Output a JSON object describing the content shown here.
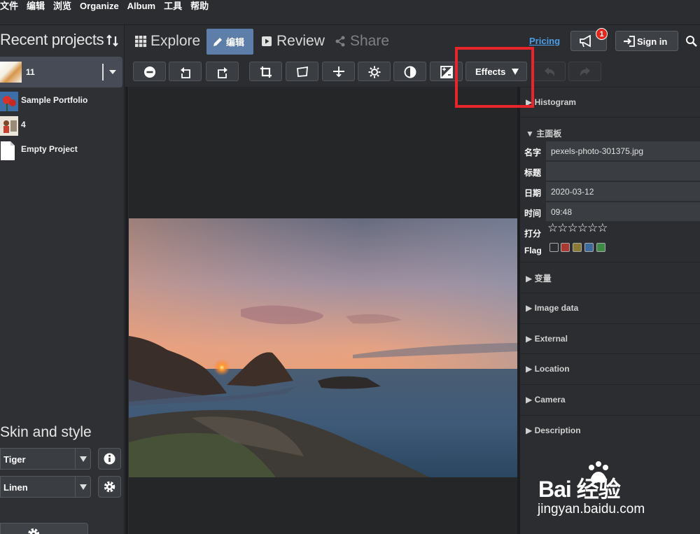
{
  "menubar": {
    "items": [
      "文件",
      "编辑",
      "浏览",
      "Organize",
      "Album",
      "工具",
      "帮助"
    ]
  },
  "sidebar": {
    "title": "Recent projects",
    "selected_project": "11",
    "projects": [
      {
        "label": "Sample Portfolio"
      },
      {
        "label": "4"
      },
      {
        "label": "Empty Project"
      }
    ],
    "skin_title": "Skin and style",
    "skin_select": "Tiger",
    "style_select": "Linen",
    "settings_label": "设置"
  },
  "header": {
    "tabs": {
      "explore": "Explore",
      "edit": "编辑",
      "review": "Review",
      "share": "Share"
    },
    "pricing": "Pricing",
    "notification_count": "1",
    "signin": "Sign in"
  },
  "toolbar": {
    "effects_label": "Effects"
  },
  "right_panel": {
    "histogram": "Histogram",
    "main_panel": "主面板",
    "fields": [
      {
        "key": "名字",
        "value": "pexels-photo-301375.jpg"
      },
      {
        "key": "标题",
        "value": ""
      },
      {
        "key": "日期",
        "value": "2020-03-12"
      },
      {
        "key": "时间",
        "value": "09:48"
      }
    ],
    "rating_label": "打分",
    "rating_stars": "☆☆☆☆☆☆",
    "flag_label": "Flag",
    "flag_colors": [
      "#1a1a1a",
      "#a83a33",
      "#8a7a35",
      "#3c6a9a",
      "#3d8a45"
    ],
    "sections": [
      "变量",
      "Image data",
      "External",
      "Location",
      "Camera",
      "Description"
    ]
  },
  "watermark": {
    "brand": "Bai 经验",
    "url": "jingyan.baidu.com"
  },
  "colors": {
    "accent": "#5d7ea8",
    "pricing": "#4a9fe8",
    "highlight": "#e8252a"
  }
}
